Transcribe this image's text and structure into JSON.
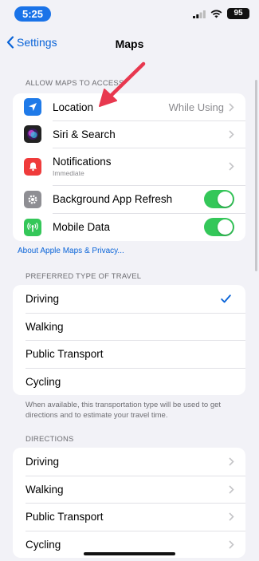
{
  "status_bar": {
    "time": "5:25",
    "battery": "95"
  },
  "nav": {
    "back_label": "Settings",
    "title": "Maps"
  },
  "access_section": {
    "header": "ALLOW MAPS TO ACCESS",
    "items": [
      {
        "label": "Location",
        "value": "While Using",
        "icon": "location-arrow-icon",
        "color": "#1f7ae8"
      },
      {
        "label": "Siri & Search",
        "icon": "siri-icon",
        "color": "#222222"
      },
      {
        "label": "Notifications",
        "sub": "Immediate",
        "icon": "notification-bell-icon",
        "color": "#ef3b3b"
      },
      {
        "label": "Background App Refresh",
        "icon": "gear-icon",
        "color": "#8e8e93",
        "toggle": true
      },
      {
        "label": "Mobile Data",
        "icon": "antenna-icon",
        "color": "#34c759",
        "toggle": true
      }
    ]
  },
  "privacy_link": "About Apple Maps & Privacy...",
  "travel_section": {
    "header": "PREFERRED TYPE OF TRAVEL",
    "items": [
      "Driving",
      "Walking",
      "Public Transport",
      "Cycling"
    ],
    "selected": "Driving",
    "footer": "When available, this transportation type will be used to get directions and to estimate your travel time."
  },
  "directions_section": {
    "header": "DIRECTIONS",
    "items": [
      "Driving",
      "Walking",
      "Public Transport",
      "Cycling"
    ]
  },
  "colors": {
    "accent": "#0a64d8",
    "toggle_on": "#34c759",
    "annotation_arrow": "#e8384f"
  }
}
